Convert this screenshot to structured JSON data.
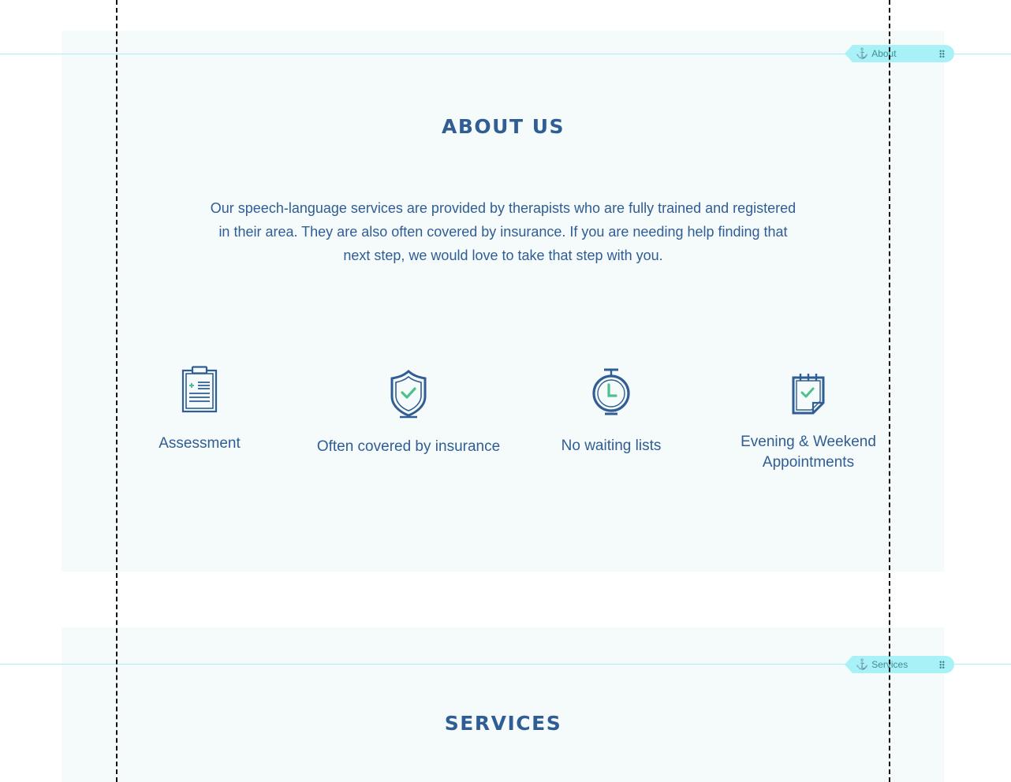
{
  "anchors": [
    {
      "label": "About"
    },
    {
      "label": "Services"
    }
  ],
  "about": {
    "title": "ABOUT US",
    "text": "Our speech-language services are provided by therapists who are fully trained and registered in their area. They are also often covered by insurance. If you are needing help finding that next step, we would love to take that step with you.",
    "features": [
      {
        "label": "Assessment",
        "icon": "clipboard-icon"
      },
      {
        "label": "Often covered by insurance",
        "icon": "shield-check-icon"
      },
      {
        "label": "No waiting lists",
        "icon": "stopwatch-icon"
      },
      {
        "label": "Evening & Weekend Appointments",
        "icon": "calendar-check-icon"
      }
    ]
  },
  "services": {
    "title": "SERVICES"
  },
  "colors": {
    "primary": "#2f5d94",
    "accent": "#4fc08d",
    "strip_background": "#f5fbfb",
    "anchor": "#a8f2f7"
  }
}
